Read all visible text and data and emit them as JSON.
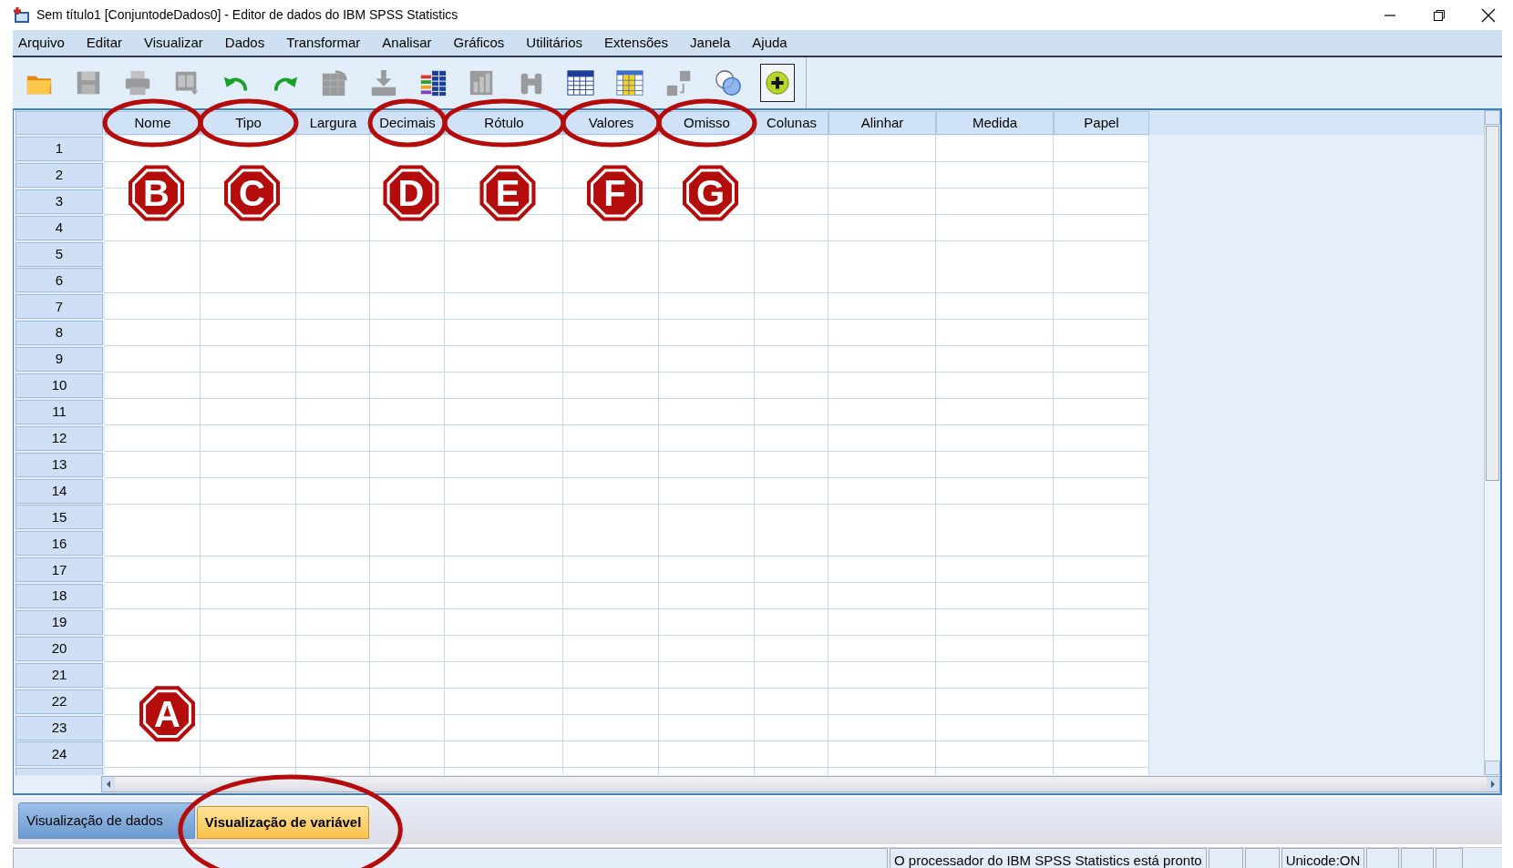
{
  "window": {
    "title": "Sem título1 [ConjuntodeDados0] - Editor de dados do IBM SPSS Statistics"
  },
  "menu": [
    {
      "label": "Arquivo"
    },
    {
      "label": "Editar"
    },
    {
      "label": "Visualizar"
    },
    {
      "label": "Dados"
    },
    {
      "label": "Transformar"
    },
    {
      "label": "Analisar"
    },
    {
      "label": "Gráficos"
    },
    {
      "label": "Utilitários"
    },
    {
      "label": "Extensões"
    },
    {
      "label": "Janela"
    },
    {
      "label": "Ajuda"
    }
  ],
  "toolbar": [
    {
      "kind": "folder",
      "disabled": false
    },
    {
      "kind": "save",
      "disabled": true
    },
    {
      "kind": "print",
      "disabled": true
    },
    {
      "kind": "recall",
      "disabled": true
    },
    {
      "kind": "undo",
      "disabled": false
    },
    {
      "kind": "redo",
      "disabled": false
    },
    {
      "kind": "goto-case",
      "disabled": true
    },
    {
      "kind": "goto-variable",
      "disabled": true
    },
    {
      "kind": "variables",
      "disabled": false
    },
    {
      "kind": "descriptives",
      "disabled": true
    },
    {
      "kind": "find",
      "disabled": true
    },
    {
      "kind": "insert-cases",
      "disabled": false
    },
    {
      "kind": "insert-variable",
      "disabled": false
    },
    {
      "kind": "split-file",
      "disabled": true
    },
    {
      "kind": "value-labels",
      "disabled": false
    },
    {
      "kind": "use-sets",
      "disabled": false,
      "pressed": true
    }
  ],
  "table": {
    "columns": [
      {
        "label": "Nome",
        "circled": true,
        "marker": "B"
      },
      {
        "label": "Tipo",
        "circled": true,
        "marker": "C"
      },
      {
        "label": "Largura",
        "circled": false
      },
      {
        "label": "Decimais",
        "circled": true,
        "marker": "D"
      },
      {
        "label": "Rótulo",
        "circled": true,
        "marker": "E"
      },
      {
        "label": "Valores",
        "circled": true,
        "marker": "F"
      },
      {
        "label": "Omisso",
        "circled": true,
        "marker": "G"
      },
      {
        "label": "Colunas",
        "circled": false
      },
      {
        "label": "Alinhar",
        "circled": false
      },
      {
        "label": "Medida",
        "circled": false
      },
      {
        "label": "Papel",
        "circled": false
      }
    ],
    "rows": [
      {
        "number": "1"
      },
      {
        "number": "2"
      },
      {
        "number": "3"
      },
      {
        "number": "4"
      },
      {
        "number": "5"
      },
      {
        "number": "6"
      },
      {
        "number": "7"
      },
      {
        "number": "8"
      },
      {
        "number": "9"
      },
      {
        "number": "10"
      },
      {
        "number": "11"
      },
      {
        "number": "12"
      },
      {
        "number": "13"
      },
      {
        "number": "14"
      },
      {
        "number": "15"
      },
      {
        "number": "16"
      },
      {
        "number": "17"
      },
      {
        "number": "18"
      },
      {
        "number": "19"
      },
      {
        "number": "20"
      },
      {
        "number": "21"
      },
      {
        "number": "22",
        "marker": "A"
      },
      {
        "number": "23"
      },
      {
        "number": "24"
      }
    ]
  },
  "tabs": [
    {
      "label": "Visualização de dados",
      "selected": false,
      "circled": false
    },
    {
      "label": "Visualização de variável",
      "selected": true,
      "circled": true
    }
  ],
  "status_bar": {
    "message": "O processador do IBM SPSS Statistics  está pronto",
    "encoding": "Unicode:ON"
  }
}
